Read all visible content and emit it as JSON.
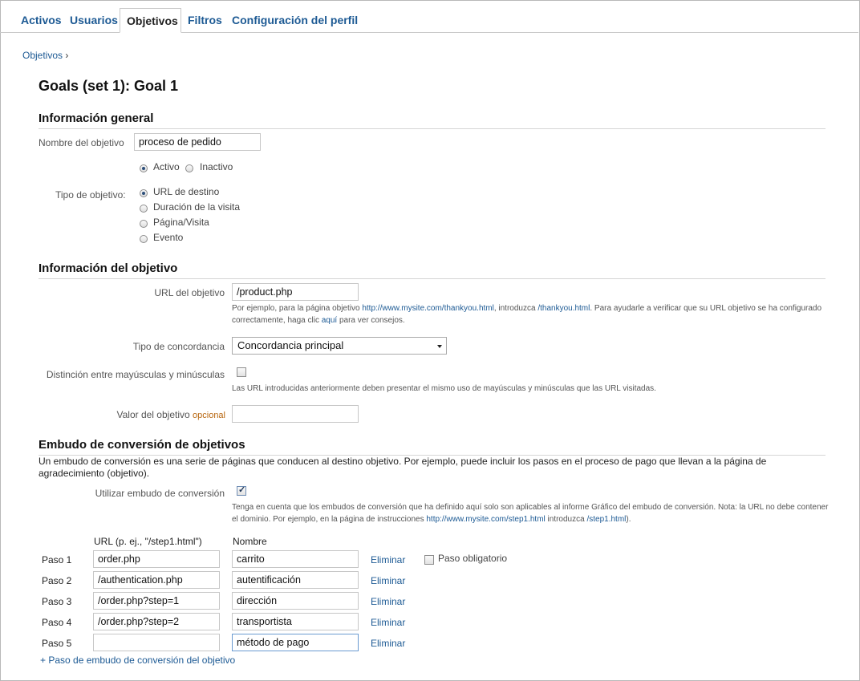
{
  "tabs": [
    "Activos",
    "Usuarios",
    "Objetivos",
    "Filtros",
    "Configuración del perfil"
  ],
  "breadcrumb": {
    "label": "Objetivos",
    "sep": "›"
  },
  "page_title": "Goals (set 1): Goal 1",
  "general": {
    "title": "Información general",
    "name_label": "Nombre del objetivo",
    "name_value": "proceso de pedido",
    "status_active": "Activo",
    "status_inactive": "Inactivo",
    "status_selected": "Activo",
    "type_label": "Tipo de objetivo:",
    "types": [
      "URL de destino",
      "Duración de la visita",
      "Página/Visita",
      "Evento"
    ],
    "type_selected": "URL de destino"
  },
  "goal_info": {
    "title": "Información del objetivo",
    "url_label": "URL del objetivo",
    "url_value": "/product.php",
    "help_1": "Por ejemplo, para la página objetivo ",
    "help_link1": "http://www.mysite.com/thankyou.html",
    "help_2": ", introduzca ",
    "help_link2": "/thankyou.html",
    "help_3": ". Para ayudarle a verificar que su URL objetivo se ha configurado correctamente, haga clic ",
    "help_link3": "aquí",
    "help_4": " para ver consejos.",
    "match_label": "Tipo de concordancia",
    "match_value": "Concordancia principal",
    "case_label": "Distinción entre mayúsculas y minúsculas",
    "case_checked": false,
    "case_help": "Las URL introducidas anteriormente deben presentar el mismo uso de mayúsculas y minúsculas que las URL visitadas.",
    "value_label": "Valor del objetivo",
    "value_optional": "opcional",
    "value_value": ""
  },
  "funnel": {
    "title": "Embudo de conversión de objetivos",
    "description": "Un embudo de conversión es una serie de páginas que conducen al destino objetivo. Por ejemplo, puede incluir los pasos en el proceso de pago que llevan a la página de agradecimiento (objetivo).",
    "use_label": "Utilizar embudo de conversión",
    "use_checked": true,
    "note_1": "Tenga en cuenta que los embudos de conversión que ha definido aquí solo son aplicables al informe Gráfico del embudo de conversión. Nota: la URL no debe contener el dominio. Por ejemplo, en la página de instrucciones ",
    "note_link1": "http://www.mysite.com/step1.html",
    "note_2": " introduzca ",
    "note_link2": "/step1.html",
    "note_3": ").",
    "col_url": "URL (p. ej., \"/step1.html\")",
    "col_name": "Nombre",
    "remove_label": "Eliminar",
    "required_label": "Paso obligatorio",
    "steps": [
      {
        "label": "Paso 1",
        "url": "order.php",
        "name": "carrito"
      },
      {
        "label": "Paso 2",
        "url": "/authentication.php",
        "name": "autentificación"
      },
      {
        "label": "Paso 3",
        "url": "/order.php?step=1",
        "name": "dirección"
      },
      {
        "label": "Paso 4",
        "url": "/order.php?step=2",
        "name": "transportista"
      },
      {
        "label": "Paso 5",
        "url": "",
        "name": "método de pago"
      }
    ],
    "add_step": "+ Paso de embudo de conversión del objetivo"
  }
}
